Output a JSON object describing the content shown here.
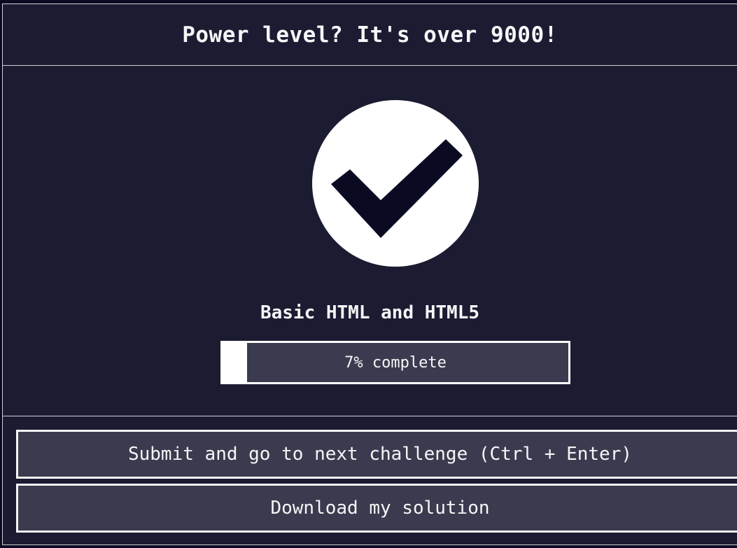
{
  "modal": {
    "title": "Power level? It's over 9000!"
  },
  "completion": {
    "icon": "check-circle-icon",
    "block_title": "Basic HTML and HTML5",
    "progress_percent": 7,
    "progress_label": "7% complete"
  },
  "actions": {
    "submit_label": "Submit and go to next challenge (Ctrl + Enter)",
    "download_label": "Download my solution"
  },
  "colors": {
    "modal_bg": "#1b1b32",
    "button_bg": "#3b3b4f",
    "text": "#f5f6f7",
    "check_mark": "#0a0a23"
  }
}
